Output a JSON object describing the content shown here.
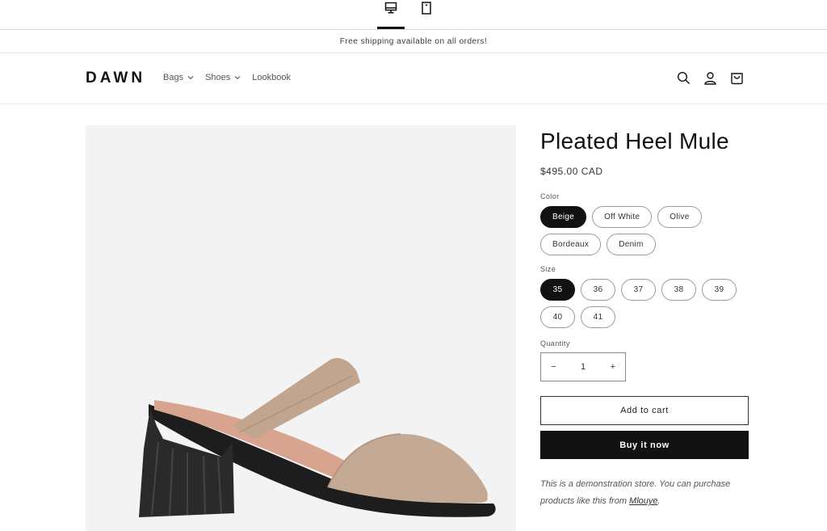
{
  "device_toggle": {
    "desktop_icon": "desktop-icon",
    "mobile_icon": "mobile-icon",
    "selected": "desktop"
  },
  "announcement": {
    "text": "Free shipping available on all orders!"
  },
  "header": {
    "logo": "DAWN",
    "nav": [
      {
        "label": "Bags",
        "has_dropdown": true
      },
      {
        "label": "Shoes",
        "has_dropdown": true
      },
      {
        "label": "Lookbook",
        "has_dropdown": false
      }
    ],
    "icons": [
      "search-icon",
      "account-icon",
      "cart-icon"
    ]
  },
  "product": {
    "image_alt": "Pleated Heel Mule",
    "title": "Pleated Heel Mule",
    "price": "$495.00 CAD",
    "color_label": "Color",
    "colors": [
      "Beige",
      "Off White",
      "Olive",
      "Bordeaux",
      "Denim"
    ],
    "selected_color": "Beige",
    "size_label": "Size",
    "sizes": [
      "35",
      "36",
      "37",
      "38",
      "39",
      "40",
      "41"
    ],
    "selected_size": "35",
    "quantity_label": "Quantity",
    "quantity": "1",
    "minus": "−",
    "plus": "+",
    "add_to_cart": "Add to cart",
    "buy_now": "Buy it now",
    "demo_text": "This is a demonstration store. You can purchase products like this from ",
    "demo_link": "Mlouye",
    "demo_end": "."
  },
  "colors": {
    "primary": "#121212",
    "media_bg": "#f3f3f3"
  }
}
